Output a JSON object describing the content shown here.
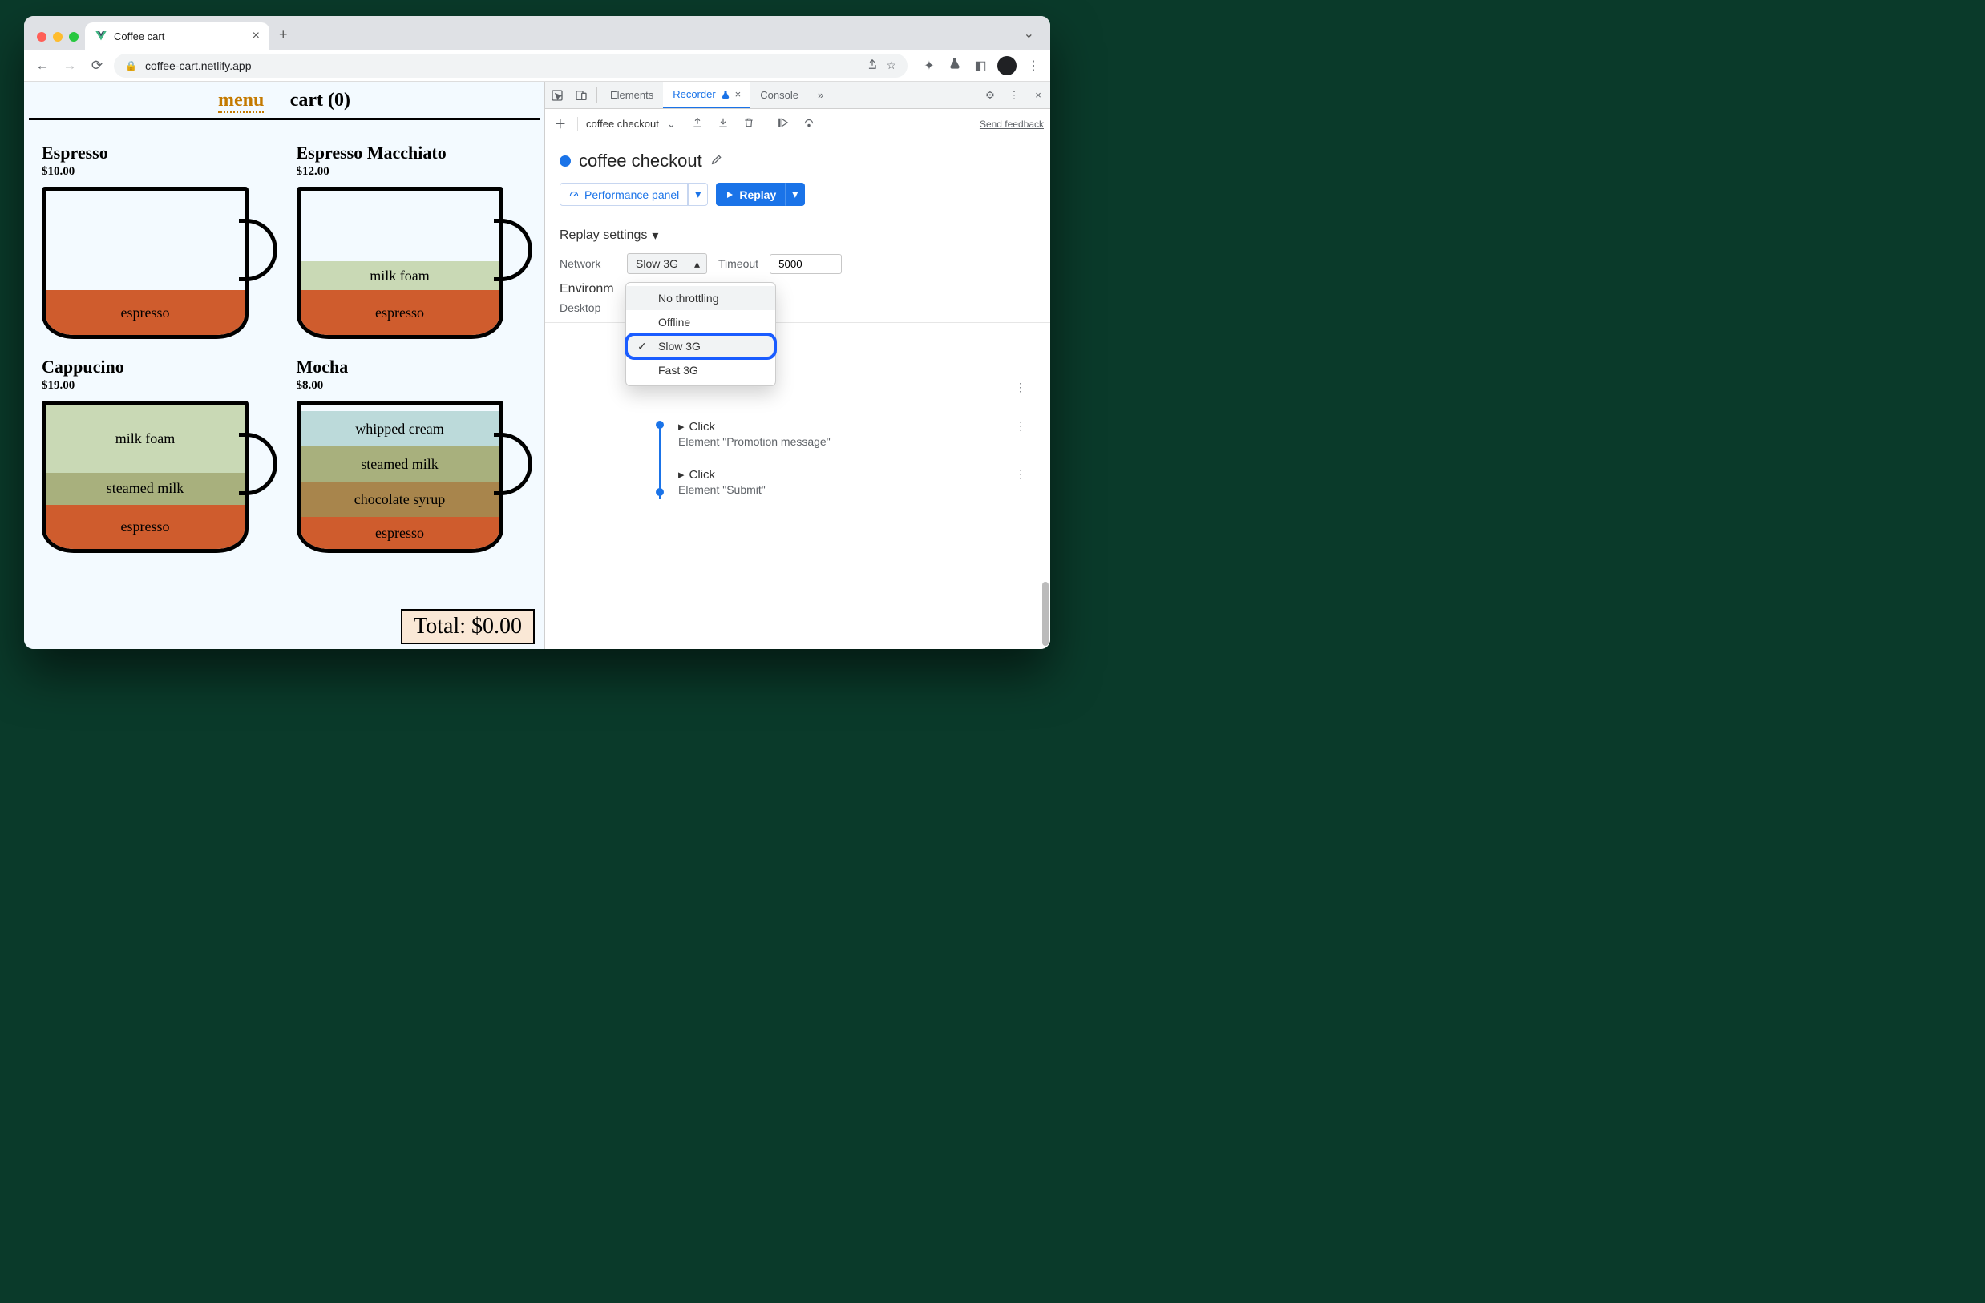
{
  "browser": {
    "tab_title": "Coffee cart",
    "url": "coffee-cart.netlify.app"
  },
  "site": {
    "nav_menu": "menu",
    "nav_cart": "cart (0)",
    "total_label": "Total: $0.00",
    "products": {
      "p1": {
        "title": "Espresso",
        "price": "$10.00",
        "layers": {
          "l0": "espresso"
        }
      },
      "p2": {
        "title": "Espresso Macchiato",
        "price": "$12.00",
        "layers": {
          "l0": "espresso",
          "l1": "milk foam"
        }
      },
      "p3": {
        "title": "Cappucino",
        "price": "$19.00",
        "layers": {
          "l0": "espresso",
          "l1": "steamed milk",
          "l2": "milk foam"
        }
      },
      "p4": {
        "title": "Mocha",
        "price": "$8.00",
        "layers": {
          "l0": "espresso",
          "l1": "chocolate syrup",
          "l2": "steamed milk",
          "l3": "whipped cream"
        }
      }
    }
  },
  "devtools": {
    "tabs": {
      "elements": "Elements",
      "recorder": "Recorder",
      "console": "Console",
      "more": "»"
    },
    "toolbar": {
      "recording_name": "coffee checkout",
      "feedback": "Send feedback"
    },
    "header": {
      "title": "coffee checkout"
    },
    "buttons": {
      "perf": "Performance panel",
      "replay": "Replay"
    },
    "settings": {
      "heading": "Replay settings",
      "network_label": "Network",
      "network_value": "Slow 3G",
      "timeout_label": "Timeout",
      "timeout_value": "5000",
      "env_heading": "Environm",
      "desktop_label": "Desktop",
      "dropdown": {
        "o0": "No throttling",
        "o1": "Offline",
        "o2": "Slow 3G",
        "o3": "Fast 3G"
      }
    },
    "steps": {
      "s1": {
        "title": "Click",
        "desc": "Element \"Promotion message\""
      },
      "s2": {
        "title": "Click",
        "desc": "Element \"Submit\""
      }
    }
  }
}
